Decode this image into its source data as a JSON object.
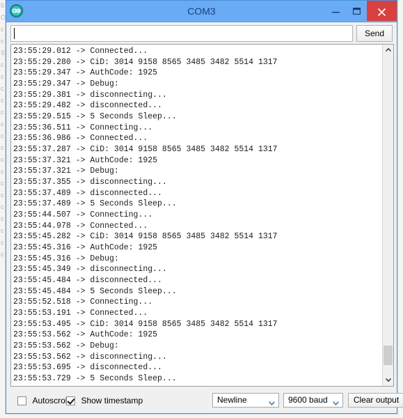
{
  "window": {
    "title": "COM3",
    "app_icon": "arduino-logo-icon",
    "controls": {
      "minimize": "minimize-icon",
      "maximize": "maximize-icon",
      "close": "close-icon"
    },
    "colors": {
      "title_bar": "#6aabf5",
      "title_text": "#12407c",
      "close_button": "#d94040",
      "window_border": "#4a90d9",
      "chrome": "#f0f0f0",
      "log_background": "#ffffff",
      "log_text": "#1a1a1a",
      "scroll_thumb": "#cdcdcd"
    }
  },
  "send_row": {
    "input_value": "",
    "input_placeholder": "",
    "send_label": "Send"
  },
  "log": {
    "lines": [
      "23:55:29.012 -> Connected...",
      "23:55:29.280 -> CiD: 3014 9158 8565 3485 3482 5514 1317",
      "23:55:29.347 -> AuthCode: 1925",
      "23:55:29.347 -> Debug:",
      "23:55:29.381 -> disconnecting...",
      "23:55:29.482 -> disconnected...",
      "23:55:29.515 -> 5 Seconds Sleep...",
      "23:55:36.511 -> Connecting...",
      "23:55:36.986 -> Connected...",
      "23:55:37.287 -> CiD: 3014 9158 8565 3485 3482 5514 1317",
      "23:55:37.321 -> AuthCode: 1925",
      "23:55:37.321 -> Debug:",
      "23:55:37.355 -> disconnecting...",
      "23:55:37.489 -> disconnected...",
      "23:55:37.489 -> 5 Seconds Sleep...",
      "23:55:44.507 -> Connecting...",
      "23:55:44.978 -> Connected...",
      "23:55:45.282 -> CiD: 3014 9158 8565 3485 3482 5514 1317",
      "23:55:45.316 -> AuthCode: 1925",
      "23:55:45.316 -> Debug:",
      "23:55:45.349 -> disconnecting...",
      "23:55:45.484 -> disconnected...",
      "23:55:45.484 -> 5 Seconds Sleep...",
      "23:55:52.518 -> Connecting...",
      "23:55:53.191 -> Connected...",
      "23:55:53.495 -> CiD: 3014 9158 8565 3485 3482 5514 1317",
      "23:55:53.562 -> AuthCode: 1925",
      "23:55:53.562 -> Debug:",
      "23:55:53.562 -> disconnecting...",
      "23:55:53.695 -> disconnected...",
      "23:55:53.729 -> 5 Seconds Sleep..."
    ],
    "scrollbar": {
      "up_arrow_icon": "chevron-up-icon",
      "down_arrow_icon": "chevron-down-icon"
    }
  },
  "bottom_bar": {
    "autoscroll_label": "Autoscroll",
    "autoscroll_checked": false,
    "timestamp_label": "Show timestamp",
    "timestamp_checked": true,
    "line_ending_value": "Newline",
    "baud_rate_value": "9600 baud",
    "clear_output_label": "Clear output",
    "dropdown_icon": "chevron-down-icon"
  },
  "backdrop": {
    "artifact_glyphs": [
      "5",
      "O",
      "c",
      "c",
      "S",
      "c",
      "c",
      "c",
      "c",
      "c",
      "c",
      "c",
      "c",
      "c",
      "c",
      "c",
      "c",
      "c",
      "c",
      "c",
      "c",
      "c"
    ]
  }
}
